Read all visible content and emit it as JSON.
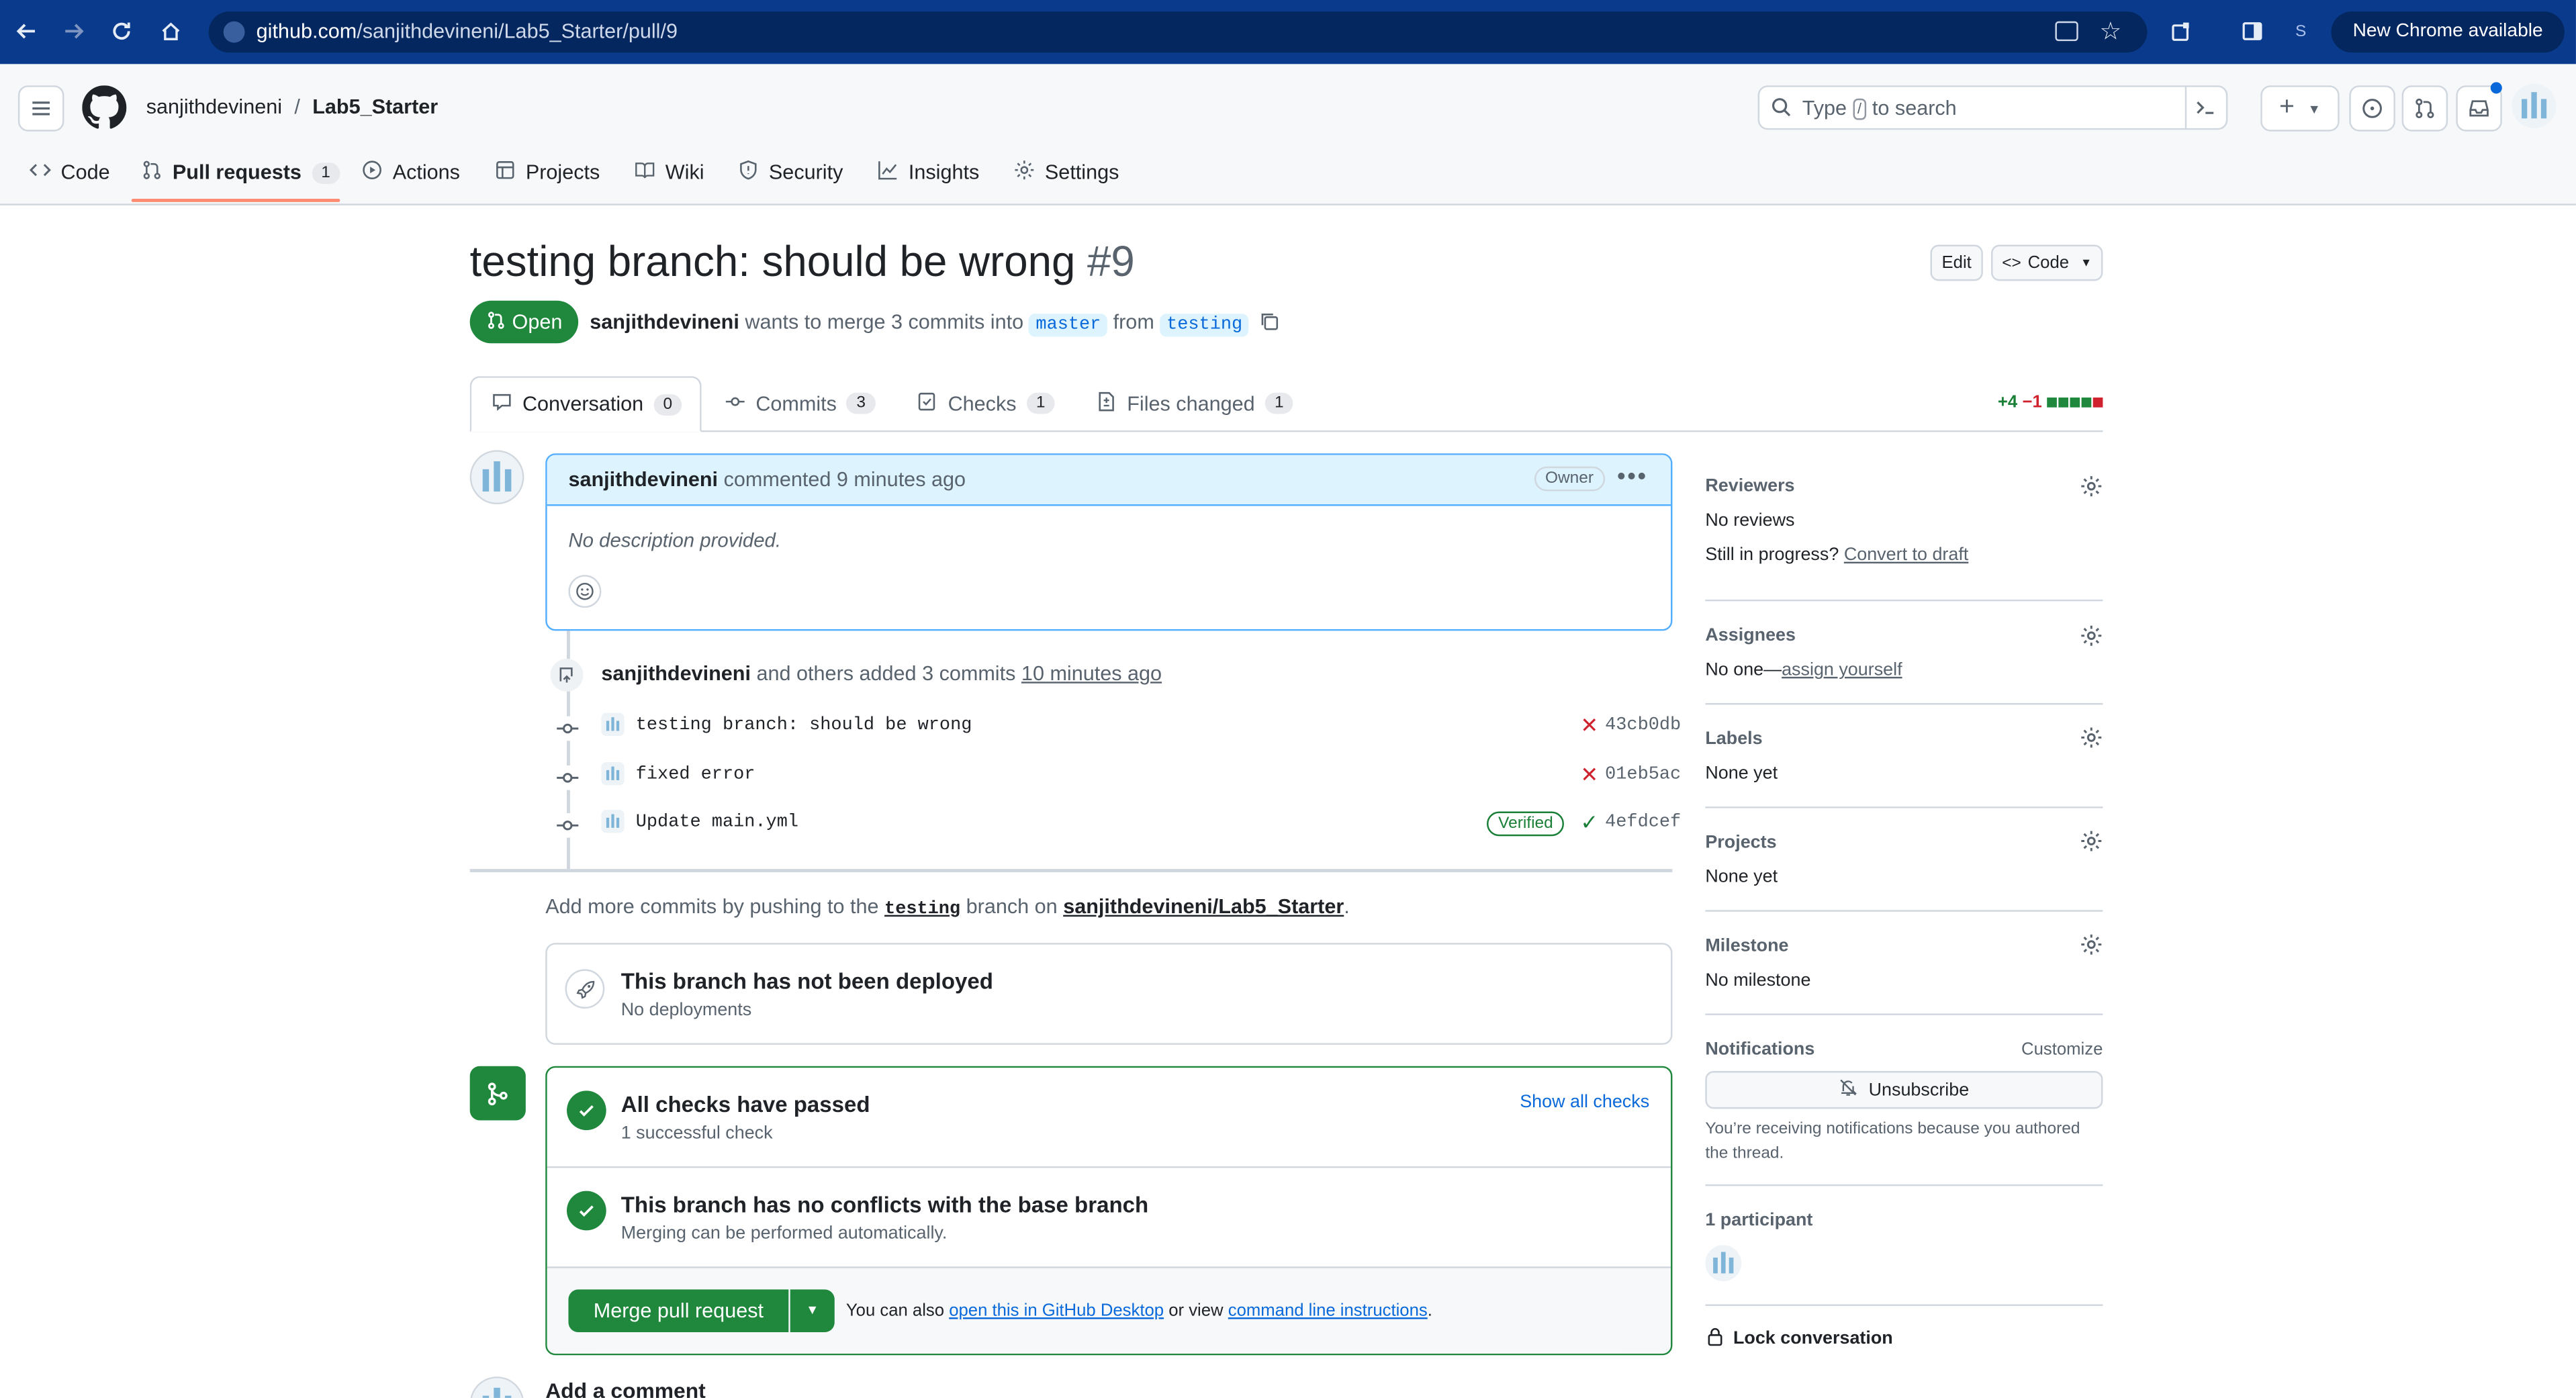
{
  "browser": {
    "url_host": "github.com",
    "url_path": "/sanjithdevineni/Lab5_Starter/pull/9",
    "profile_initial": "S",
    "new_chrome_label": "New Chrome available"
  },
  "header": {
    "owner": "sanjithdevineni",
    "separator": "/",
    "repo": "Lab5_Starter",
    "search_placeholder_pre": "Type",
    "search_key": "/",
    "search_placeholder_post": "to search"
  },
  "repo_nav": {
    "code": "Code",
    "pull_requests": "Pull requests",
    "pull_requests_count": "1",
    "actions": "Actions",
    "projects": "Projects",
    "wiki": "Wiki",
    "security": "Security",
    "insights": "Insights",
    "settings": "Settings"
  },
  "pr": {
    "title": "testing branch: should be wrong",
    "number": "#9",
    "state": "Open",
    "author": "sanjithdevineni",
    "merge_text": "wants to merge 3 commits into",
    "base_branch": "master",
    "from_text": "from",
    "head_branch": "testing",
    "edit_label": "Edit",
    "code_label": "Code"
  },
  "pr_tabs": {
    "conversation": "Conversation",
    "conversation_count": "0",
    "commits": "Commits",
    "commits_count": "3",
    "checks": "Checks",
    "checks_count": "1",
    "files_changed": "Files changed",
    "files_changed_count": "1",
    "additions": "+4",
    "deletions": "−1"
  },
  "comment": {
    "author": "sanjithdevineni",
    "action": "commented",
    "time": "9 minutes ago",
    "role": "Owner",
    "body": "No description provided."
  },
  "commits_event": {
    "author": "sanjithdevineni",
    "text": "and others added 3 commits",
    "time": "10 minutes ago",
    "items": [
      {
        "message": "testing branch: should be wrong",
        "sha": "43cb0db",
        "status": "failure",
        "verified": ""
      },
      {
        "message": "fixed error",
        "sha": "01eb5ac",
        "status": "failure",
        "verified": ""
      },
      {
        "message": "Update main.yml",
        "sha": "4efdcef",
        "status": "success",
        "verified": "Verified"
      }
    ]
  },
  "push_hint": {
    "pre": "Add more commits by pushing to the",
    "branch": "testing",
    "mid": "branch on",
    "repo": "sanjithdevineni/Lab5_Starter",
    "post": "."
  },
  "deploy": {
    "title": "This branch has not been deployed",
    "subtitle": "No deployments"
  },
  "merge_box": {
    "checks_title": "All checks have passed",
    "checks_subtitle": "1 successful check",
    "show_all": "Show all checks",
    "conflicts_title": "This branch has no conflicts with the base branch",
    "conflicts_subtitle": "Merging can be performed automatically.",
    "merge_button": "Merge pull request",
    "also_pre": "You can also",
    "desktop_link": "open this in GitHub Desktop",
    "or_view": "or view",
    "cli_link": "command line instructions",
    "post": "."
  },
  "add_comment": "Add a comment",
  "sidebar": {
    "reviewers_label": "Reviewers",
    "reviewers_value": "No reviews",
    "in_progress": "Still in progress?",
    "convert_draft": "Convert to draft",
    "assignees_label": "Assignees",
    "assignees_value": "No one—",
    "assign_yourself": "assign yourself",
    "labels_label": "Labels",
    "labels_value": "None yet",
    "projects_label": "Projects",
    "projects_value": "None yet",
    "milestone_label": "Milestone",
    "milestone_value": "No milestone",
    "notifications_label": "Notifications",
    "customize": "Customize",
    "unsubscribe": "Unsubscribe",
    "notif_reason": "You’re receiving notifications because you authored the thread.",
    "participants": "1 participant",
    "lock": "Lock conversation"
  },
  "colors": {
    "browser_bar": "#0a3a8c",
    "open_green": "#1f883d",
    "link_blue": "#0969da",
    "danger_red": "#cf222e",
    "accent_orange": "#fd8c73"
  }
}
